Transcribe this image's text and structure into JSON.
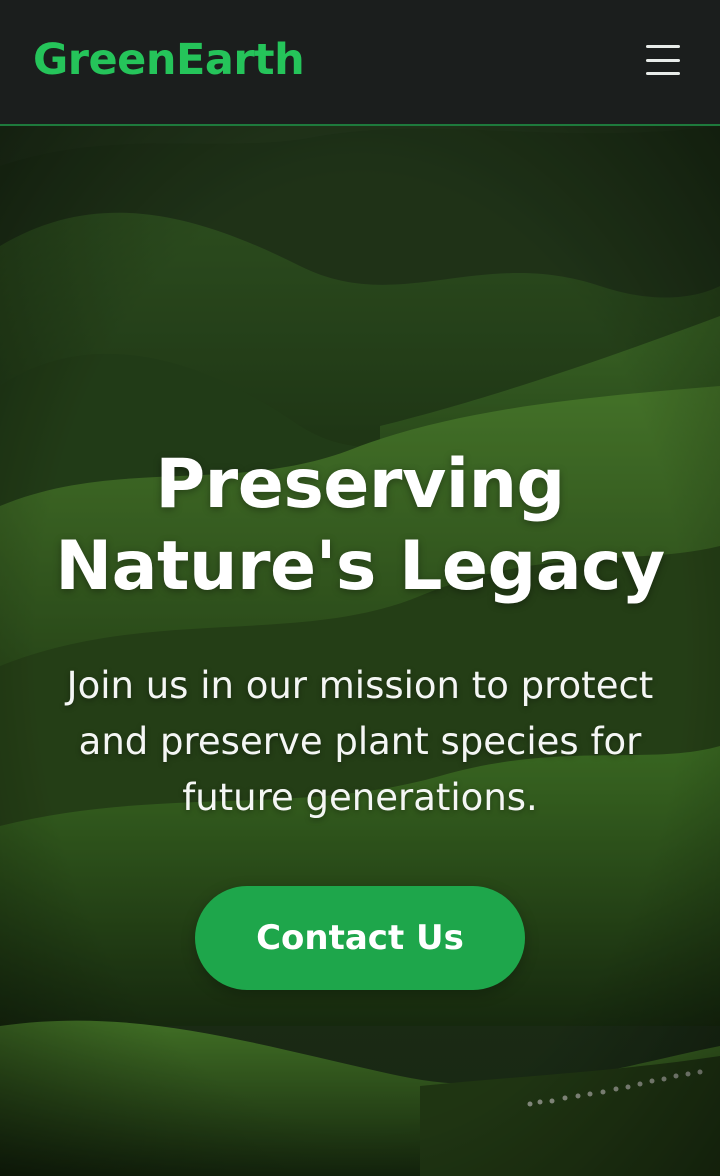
{
  "header": {
    "brand": "GreenEarth",
    "menu_icon": "hamburger-menu-icon"
  },
  "hero": {
    "title_line1": "Preserving",
    "title_line2": "Nature's Legacy",
    "subtitle": "Join us in our mission to protect and preserve plant species for future generations.",
    "cta_label": "Contact Us",
    "background_image": "rolling green hills landscape"
  },
  "colors": {
    "brand_green": "#25c45a",
    "button_green": "#1ea64b",
    "header_bg": "#1b1e1d"
  }
}
